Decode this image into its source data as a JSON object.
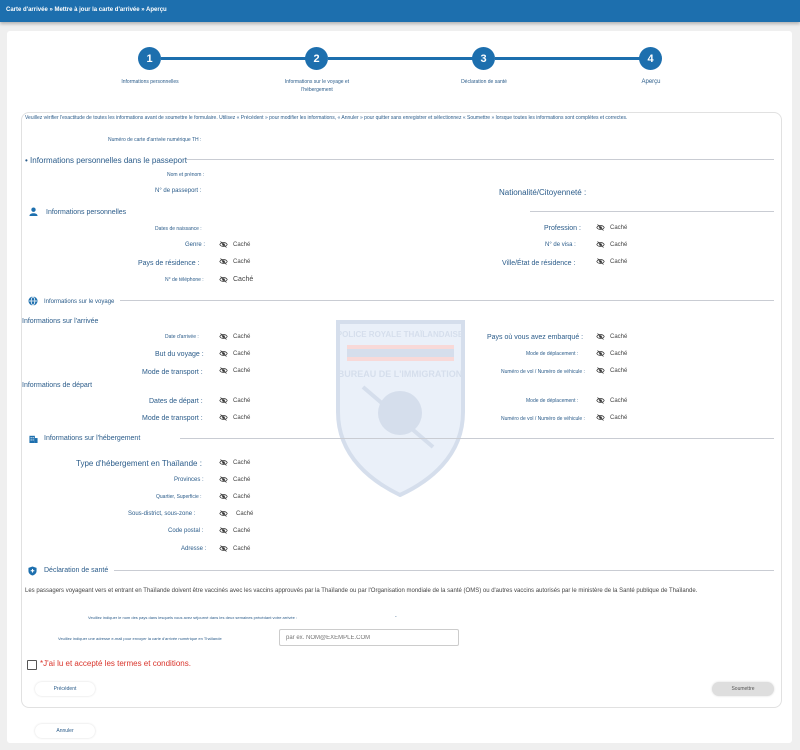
{
  "breadcrumb": "Carte d'arrivée » Mettre à jour la carte d'arrivée » Aperçu",
  "steps": [
    {
      "num": "1",
      "label": "Informations personnelles"
    },
    {
      "num": "2",
      "label": "Informations sur le voyage et l'hébergement"
    },
    {
      "num": "3",
      "label": "Déclaration de santé"
    },
    {
      "num": "4",
      "label": "Aperçu"
    }
  ],
  "instructions": "Veuillez vérifier l'exactitude de toutes les informations avant de soumettre le formulaire. Utilisez « Précédent » pour modifier les informations, « Annuler » pour quitter sans enregistrer et sélectionnez « Soumettre » lorsque toutes les informations sont complètes et correctes.",
  "card_number_label": "Numéro de carte d'arrivée numérique TH :",
  "hidden": "Caché",
  "passport": {
    "title": "• Informations personnelles dans le passeport",
    "name_label": "Nom et prénom :",
    "passport_no_label": "N° de passeport :",
    "nationality_label": "Nationalité/Citoyenneté :"
  },
  "personal": {
    "title": "Informations personnelles",
    "dob": "Dates de naissance :",
    "profession": "Profession :",
    "gender": "Genre :",
    "visa": "N° de visa :",
    "country": "Pays de résidence :",
    "city": "Ville/État de résidence :",
    "phone": "N° de téléphone :"
  },
  "travel": {
    "title": "Informations sur le voyage",
    "arrival_title": "Informations sur l'arrivée",
    "arrival_date": "Date d'arrivée :",
    "boarded_country": "Pays où vous avez embarqué :",
    "purpose": "But du voyage :",
    "travel_mode": "Mode de déplacement :",
    "transport_mode": "Mode de transport :",
    "flight_no": "Numéro de vol / Numéro de véhicule :",
    "departure_title": "Informations de départ",
    "departure_date": "Dates de départ :",
    "travel_mode2": "Mode de déplacement :",
    "transport_mode2": "Mode de transport :",
    "flight_no2": "Numéro de vol / Numéro de véhicule :"
  },
  "accommodation": {
    "title": "Informations sur l'hébergement",
    "type": "Type d'hébergement en Thaïlande :",
    "province": "Provinces :",
    "district": "Quartier, Superficie :",
    "subdistrict": "Sous-district, sous-zone :",
    "postal": "Code postal :",
    "address": "Adresse :"
  },
  "health": {
    "title": "Déclaration de santé",
    "text": "Les passagers voyageant vers et entrant en Thaïlande doivent être vaccinés avec les vaccins approuvés par la Thaïlande ou par l'Organisation mondiale de la santé (OMS) ou d'autres vaccins autorisés par le ministère de la Santé publique de Thaïlande.",
    "countries_label": "Veuillez indiquer le nom des pays dans lesquels vous avez séjourné dans les deux semaines précédant votre arrivée :",
    "countries_value": "-",
    "email_label": "Veuillez indiquer une adresse e-mail pour envoyer la carte d'arrivée numérique en Thaïlande",
    "email_placeholder": "par ex. NOM@EXEMPLE.COM",
    "terms": "*J'ai lu et accepté les termes et conditions."
  },
  "watermark": {
    "line1": "POLICE ROYALE THAÏLANDAISE",
    "line2": "BUREAU DE L'IMMIGRATION"
  },
  "buttons": {
    "previous": "Précédent",
    "submit": "Soumettre",
    "cancel": "Annuler"
  },
  "colors": {
    "primary": "#1d6fae",
    "text": "#2b5c8a",
    "terms": "#d9342b"
  }
}
